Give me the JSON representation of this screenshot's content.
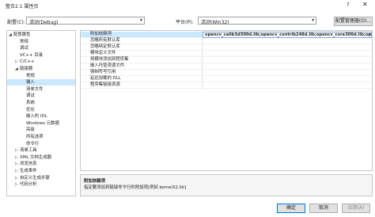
{
  "window": {
    "title": "整合2.1 属性页",
    "help": "?",
    "close": "✕"
  },
  "toolbar": {
    "config_label": "配置(C):",
    "config_value": "活动(Debug)",
    "platform_label": "平台(P):",
    "platform_value": "活动(Win32)",
    "config_manager": "配置管理器(O)..."
  },
  "tree": [
    {
      "label": "配置属性",
      "toggle": "◢"
    },
    {
      "label": "常规",
      "toggle": ""
    },
    {
      "label": "调试",
      "toggle": ""
    },
    {
      "label": "VC++ 目录",
      "toggle": ""
    },
    {
      "label": "C/C++",
      "toggle": "▷"
    },
    {
      "label": "链接器",
      "toggle": "◢"
    },
    {
      "label": "常规",
      "toggle": ""
    },
    {
      "label": "输入",
      "toggle": ""
    },
    {
      "label": "清单文件",
      "toggle": ""
    },
    {
      "label": "调试",
      "toggle": ""
    },
    {
      "label": "系统",
      "toggle": ""
    },
    {
      "label": "优化",
      "toggle": ""
    },
    {
      "label": "嵌入的 IDL",
      "toggle": ""
    },
    {
      "label": "Windows 元数据",
      "toggle": ""
    },
    {
      "label": "高级",
      "toggle": ""
    },
    {
      "label": "所有选项",
      "toggle": ""
    },
    {
      "label": "命令行",
      "toggle": ""
    },
    {
      "label": "清单工具",
      "toggle": "▷"
    },
    {
      "label": "XML 文档生成器",
      "toggle": "▷"
    },
    {
      "label": "浏览信息",
      "toggle": "▷"
    },
    {
      "label": "生成事件",
      "toggle": "▷"
    },
    {
      "label": "自定义生成步骤",
      "toggle": "▷"
    },
    {
      "label": "代码分析",
      "toggle": "▷"
    }
  ],
  "properties": [
    {
      "name": "附加依赖项",
      "value": "opencv_calib3d300d.lib;opencv_contrib248d.lib;opencv_core300d.lib;opencv_f"
    },
    {
      "name": "忽略所有默认库",
      "value": ""
    },
    {
      "name": "忽略特定默认库",
      "value": ""
    },
    {
      "name": "模块定义文件",
      "value": ""
    },
    {
      "name": "将模块添加到程序集",
      "value": ""
    },
    {
      "name": "嵌入托管资源文件",
      "value": ""
    },
    {
      "name": "强制符号引用",
      "value": ""
    },
    {
      "name": "延迟加载的 DLL",
      "value": ""
    },
    {
      "name": "程序集链接资源",
      "value": ""
    }
  ],
  "description": {
    "title": "附加依赖项",
    "text": "指定要添加到链接命令行的附加项[例如 kernel32.lib]"
  },
  "footer": {
    "ok": "确定",
    "cancel": "取消",
    "apply": "应用(A)"
  }
}
